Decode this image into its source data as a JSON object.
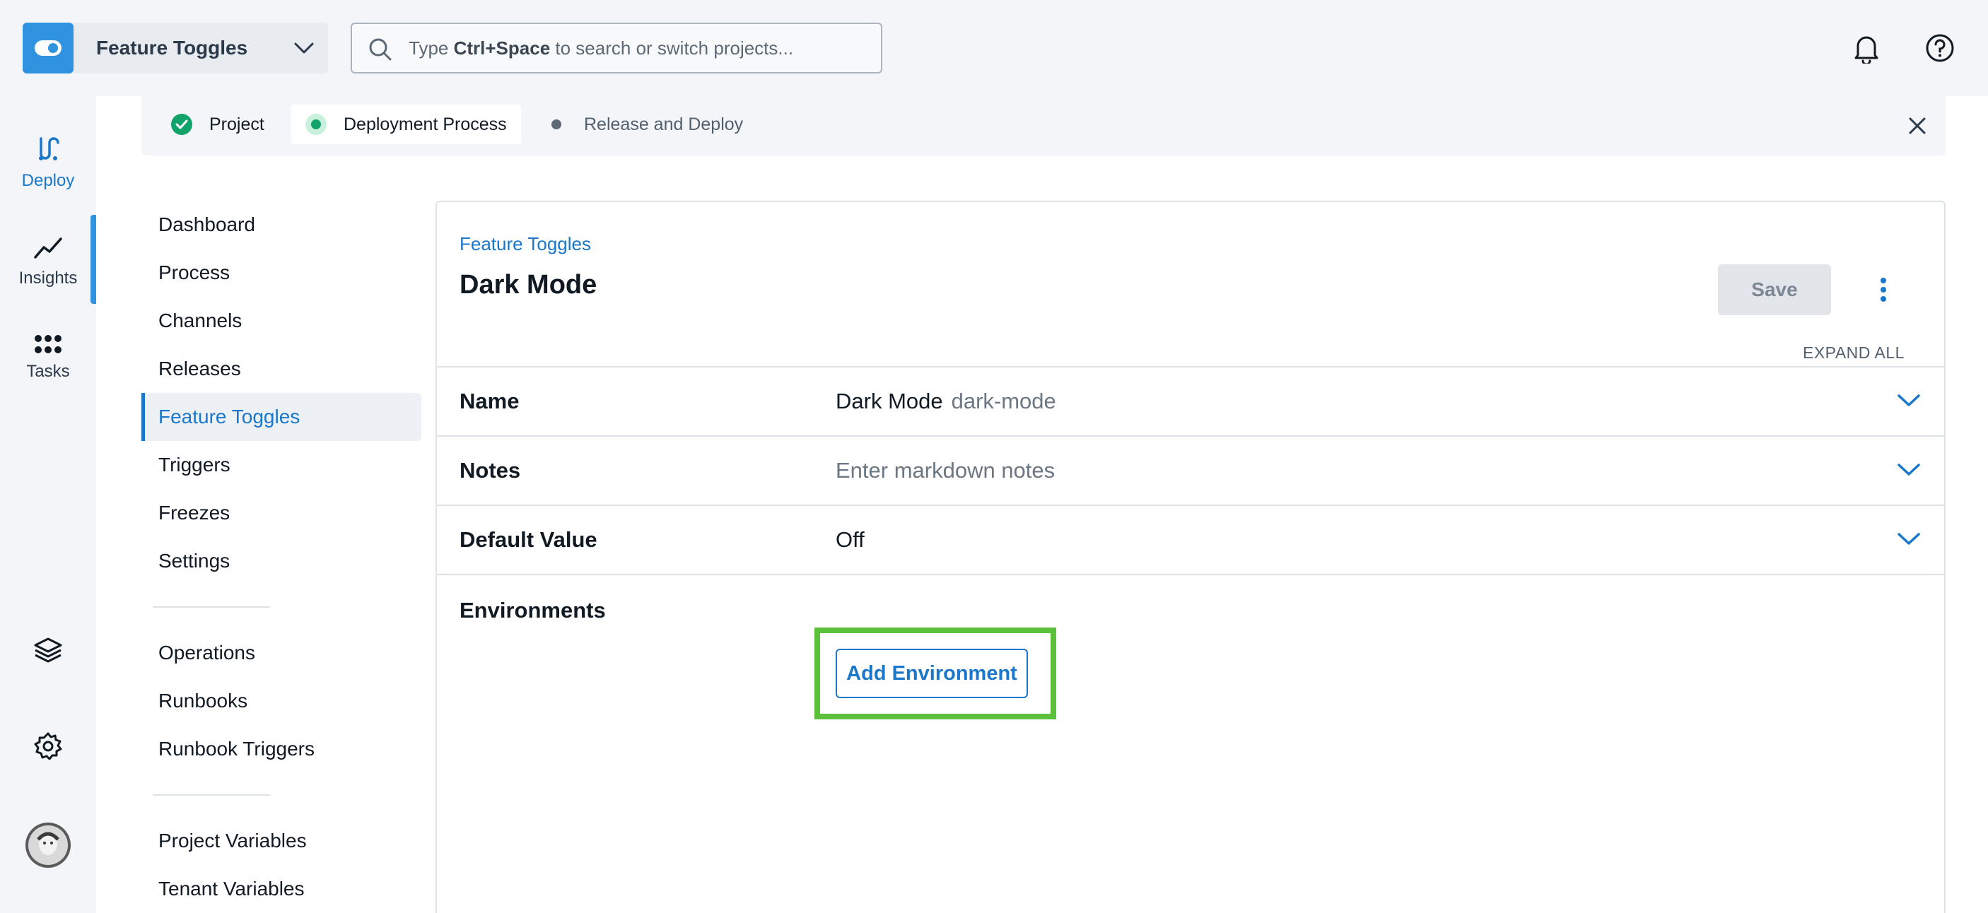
{
  "header": {
    "project_name": "Feature Toggles",
    "search": {
      "prefix": "Type ",
      "shortcut": "Ctrl+Space",
      "suffix": " to search or switch projects..."
    }
  },
  "rail": {
    "items": [
      {
        "label": "Deploy",
        "icon": "deploy-icon",
        "active": true
      },
      {
        "label": "Insights",
        "icon": "insights-icon"
      },
      {
        "label": "Tasks",
        "icon": "tasks-icon"
      }
    ],
    "bottom_icons": [
      "layers-icon",
      "gear-icon",
      "avatar"
    ]
  },
  "stepper": {
    "steps": [
      {
        "label": "Project",
        "state": "complete"
      },
      {
        "label": "Deployment Process",
        "state": "current"
      },
      {
        "label": "Release and Deploy",
        "state": "pending"
      }
    ]
  },
  "sidenav": {
    "group1": [
      "Dashboard",
      "Process",
      "Channels",
      "Releases",
      "Feature Toggles",
      "Triggers",
      "Freezes",
      "Settings"
    ],
    "group2": [
      "Operations",
      "Runbooks",
      "Runbook Triggers"
    ],
    "group3": [
      "Project Variables",
      "Tenant Variables"
    ],
    "active": "Feature Toggles"
  },
  "content": {
    "breadcrumb": "Feature Toggles",
    "title": "Dark Mode",
    "save_label": "Save",
    "expand_all": "EXPAND ALL",
    "rows": {
      "name": {
        "label": "Name",
        "value": "Dark Mode",
        "slug": "dark-mode"
      },
      "notes": {
        "label": "Notes",
        "placeholder": "Enter markdown notes"
      },
      "default_value": {
        "label": "Default Value",
        "value": "Off"
      }
    },
    "environments_label": "Environments",
    "add_environment_label": "Add Environment"
  },
  "colors": {
    "accent": "#1a77ca",
    "brand": "#2f93e0",
    "success": "#11a36a",
    "highlight": "#5cc13a"
  }
}
